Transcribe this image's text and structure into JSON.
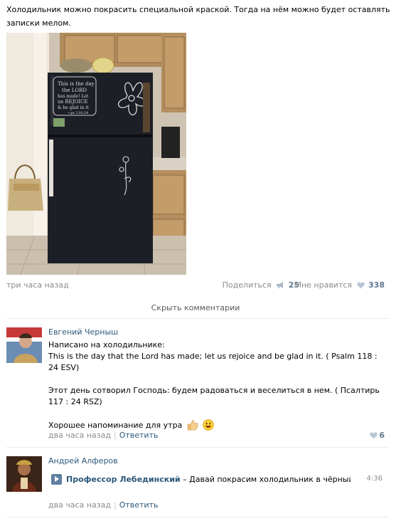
{
  "post": {
    "text": "Холодильник можно покрасить специальной краской. Тогда на нём можно будет оставлять записки мелом.",
    "time": "три часа назад",
    "share_label": "Поделиться",
    "share_count": "25",
    "like_label": "Мне нравится",
    "like_count": "338",
    "photo_chalk_text": [
      "This is the day",
      "the LORD",
      "has made! Let",
      "us REJOICE",
      "& be glad in it",
      "~ps 118:24"
    ]
  },
  "comments_toggle": "Скрыть комментарии",
  "comments": [
    {
      "author": "Евгений Черныш",
      "lines": [
        "Написано на холодильнике:",
        "This is the day that the Lord has made; let us rejoice and be glad in it. ( Psalm 118 : 24 ESV)",
        "",
        "Этот день сотворил Господь: будем радоваться и веселиться в нем. ( Псалтирь 117 : 24 RSZ)",
        "",
        "Хорошее напоминание для утра"
      ],
      "time": "два часа назад",
      "reply": "Ответить",
      "likes": "6"
    },
    {
      "author": "Андрей Алферов",
      "audio": {
        "artist": "Профессор Лебединский",
        "dash": " – ",
        "title": "Давай покрасим холодильник в чёрный цвет! ...",
        "duration": "4:36"
      },
      "time": "два часа назад",
      "reply": "Ответить"
    }
  ],
  "colors": {
    "link": "#2b587a",
    "muted": "#8b8b8b",
    "count": "#5f7891",
    "divider": "#e7ebef",
    "fridge": "#1c1f26"
  },
  "icons": {
    "share": "megaphone-icon",
    "like": "heart-icon",
    "thumbs_up": "thumbs-up-emoji",
    "smile": "smile-emoji",
    "play": "play-icon"
  }
}
